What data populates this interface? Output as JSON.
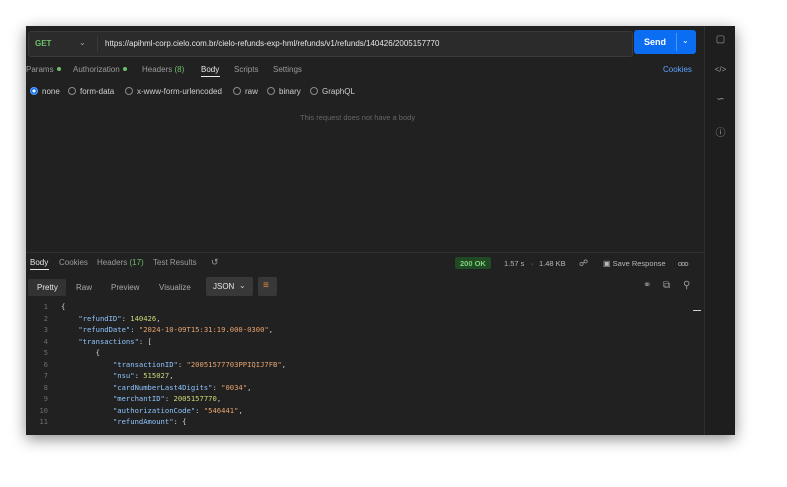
{
  "request": {
    "method": "GET",
    "url": "https://apihml-corp.cielo.com.br/cielo-refunds-exp-hml/refunds/v1/refunds/140426/2005157770",
    "send_label": "Send",
    "tabs": [
      {
        "label": "Params",
        "indicator": "dot"
      },
      {
        "label": "Authorization",
        "indicator": "dot"
      },
      {
        "label": "Headers",
        "count": "(8)"
      },
      {
        "label": "Body"
      },
      {
        "label": "Scripts"
      },
      {
        "label": "Settings"
      }
    ],
    "cookies_label": "Cookies",
    "body_types": [
      "none",
      "form-data",
      "x-www-form-urlencoded",
      "raw",
      "binary",
      "GraphQL"
    ],
    "selected_body_type": "none",
    "empty_message": "This request does not have a body"
  },
  "response": {
    "tabs": [
      {
        "label": "Body"
      },
      {
        "label": "Cookies"
      },
      {
        "label": "Headers",
        "count": "(17)"
      },
      {
        "label": "Test Results"
      }
    ],
    "status": "200 OK",
    "time": "1.57 s",
    "size": "1.48 KB",
    "save_label": "Save Response",
    "more": "ooo",
    "view_modes": [
      "Pretty",
      "Raw",
      "Preview",
      "Visualize"
    ],
    "format": "JSON",
    "code_lines": [
      {
        "n": "1",
        "indent": 0,
        "parts": [
          {
            "t": "p",
            "v": "{"
          }
        ]
      },
      {
        "n": "2",
        "indent": 1,
        "parts": [
          {
            "t": "k",
            "v": "\"refundID\""
          },
          {
            "t": "p",
            "v": ": "
          },
          {
            "t": "n",
            "v": "140426"
          },
          {
            "t": "p",
            "v": ","
          }
        ]
      },
      {
        "n": "3",
        "indent": 1,
        "parts": [
          {
            "t": "k",
            "v": "\"refundDate\""
          },
          {
            "t": "p",
            "v": ": "
          },
          {
            "t": "s",
            "v": "\"2024-10-09T15:31:19.000-0300\""
          },
          {
            "t": "p",
            "v": ","
          }
        ]
      },
      {
        "n": "4",
        "indent": 1,
        "parts": [
          {
            "t": "k",
            "v": "\"transactions\""
          },
          {
            "t": "p",
            "v": ": ["
          }
        ]
      },
      {
        "n": "5",
        "indent": 2,
        "parts": [
          {
            "t": "p",
            "v": "{"
          }
        ]
      },
      {
        "n": "6",
        "indent": 3,
        "parts": [
          {
            "t": "k",
            "v": "\"transactionID\""
          },
          {
            "t": "p",
            "v": ": "
          },
          {
            "t": "s",
            "v": "\"20051577703PPIQIJ7FB\""
          },
          {
            "t": "p",
            "v": ","
          }
        ]
      },
      {
        "n": "7",
        "indent": 3,
        "parts": [
          {
            "t": "k",
            "v": "\"nsu\""
          },
          {
            "t": "p",
            "v": ": "
          },
          {
            "t": "n",
            "v": "515027"
          },
          {
            "t": "p",
            "v": ","
          }
        ]
      },
      {
        "n": "8",
        "indent": 3,
        "parts": [
          {
            "t": "k",
            "v": "\"cardNumberLast4Digits\""
          },
          {
            "t": "p",
            "v": ": "
          },
          {
            "t": "s",
            "v": "\"0034\""
          },
          {
            "t": "p",
            "v": ","
          }
        ]
      },
      {
        "n": "9",
        "indent": 3,
        "parts": [
          {
            "t": "k",
            "v": "\"merchantID\""
          },
          {
            "t": "p",
            "v": ": "
          },
          {
            "t": "n",
            "v": "2005157770"
          },
          {
            "t": "p",
            "v": ","
          }
        ]
      },
      {
        "n": "10",
        "indent": 3,
        "parts": [
          {
            "t": "k",
            "v": "\"authorizationCode\""
          },
          {
            "t": "p",
            "v": ": "
          },
          {
            "t": "s",
            "v": "\"546441\""
          },
          {
            "t": "p",
            "v": ","
          }
        ]
      },
      {
        "n": "11",
        "indent": 3,
        "parts": [
          {
            "t": "k",
            "v": "\"refundAmount\""
          },
          {
            "t": "p",
            "v": ": {"
          }
        ]
      }
    ]
  },
  "icons": {
    "sidebar": [
      "comment-icon",
      "code-icon",
      "link-icon",
      "info-icon"
    ],
    "toolbar": [
      "history-icon",
      "wrap-lines-icon",
      "link-icon",
      "copy-icon",
      "search-icon"
    ]
  },
  "colors": {
    "send": "#0b6ef2",
    "status": "#7ed27a",
    "status_bg": "#1f4a23",
    "key": "#8ec5ff",
    "string": "#e7a36f",
    "number": "#cfd77a"
  }
}
